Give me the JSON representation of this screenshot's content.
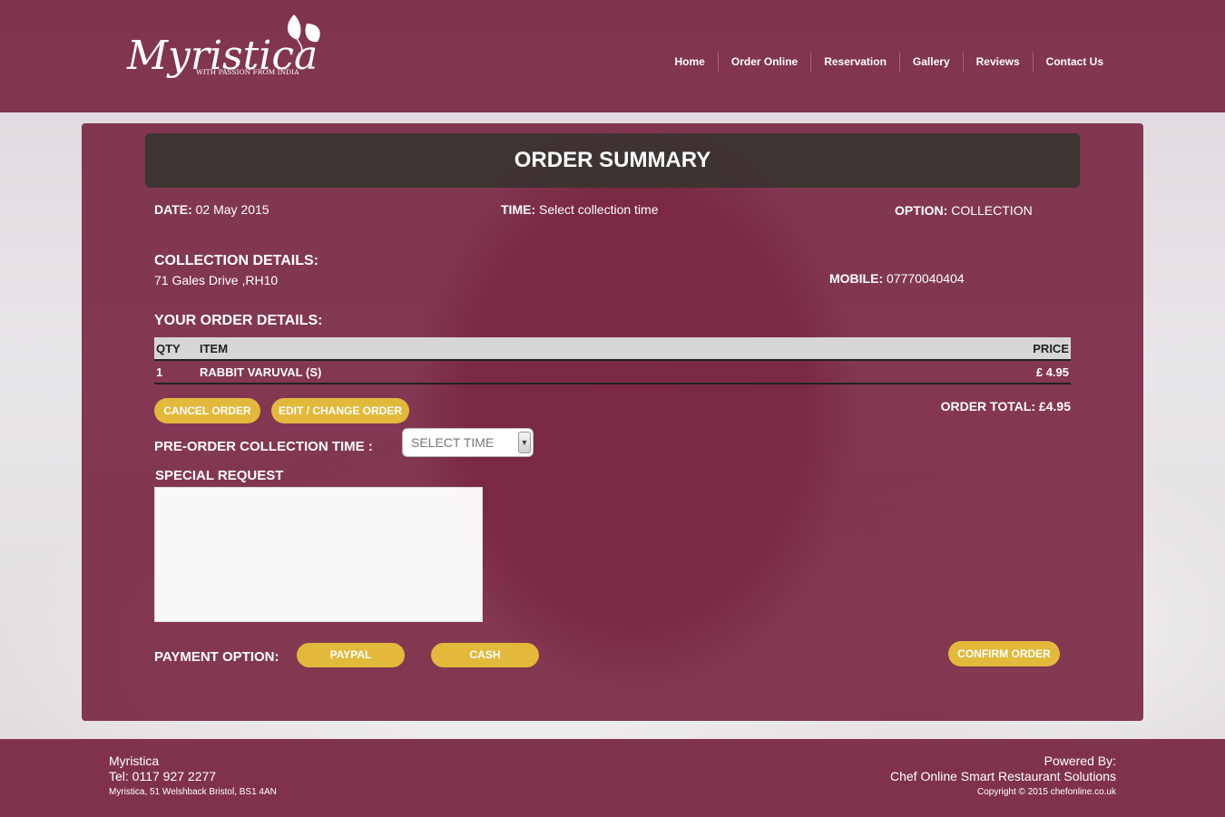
{
  "brand": {
    "logo_text": "Myristica",
    "tagline": "WITH PASSION FROM INDIA"
  },
  "nav": {
    "items": [
      "Home",
      "Order Online",
      "Reservation",
      "Gallery",
      "Reviews",
      "Contact Us"
    ]
  },
  "summary": {
    "title": "ORDER SUMMARY",
    "date_label": "DATE:",
    "date_value": "02 May 2015",
    "time_label": "TIME:",
    "time_value": "Select collection time",
    "option_label": "OPTION:",
    "option_value": "COLLECTION",
    "collection_label": "COLLECTION DETAILS:",
    "collection_address": "71 Gales Drive ,RH10",
    "mobile_label": "MOBILE:",
    "mobile_value": "07770040404",
    "order_details_label": "YOUR ORDER DETAILS:"
  },
  "order_table": {
    "headers": {
      "qty": "QTY",
      "item": "ITEM",
      "price": "PRICE"
    },
    "rows": [
      {
        "qty": "1",
        "item": "RABBIT VARUVAL (S)",
        "price": "£ 4.95"
      }
    ]
  },
  "order_total": "ORDER TOTAL: £4.95",
  "buttons": {
    "cancel": "CANCEL ORDER",
    "edit": "EDIT / CHANGE ORDER",
    "paypal": "PAYPAL",
    "cash": "CASH",
    "confirm": "CONFIRM ORDER"
  },
  "preorder": {
    "label": "PRE-ORDER COLLECTION TIME :",
    "select_value": "SELECT TIME"
  },
  "special_request": {
    "label": "SPECIAL REQUEST",
    "value": ""
  },
  "payment_label": "PAYMENT OPTION:",
  "footer": {
    "name": "Myristica",
    "tel": "Tel: 0117 927 2277",
    "address": "Myristica, 51 Welshback Bristol, BS1 4AN",
    "powered_by": "Powered By:",
    "company": "Chef Online Smart Restaurant Solutions",
    "copyright": "Copyright © 2015 chefonline.co.uk"
  },
  "colors": {
    "header_bg": "#7a2844",
    "accent_button": "#e2b93b",
    "title_bar": "#3a3430"
  }
}
